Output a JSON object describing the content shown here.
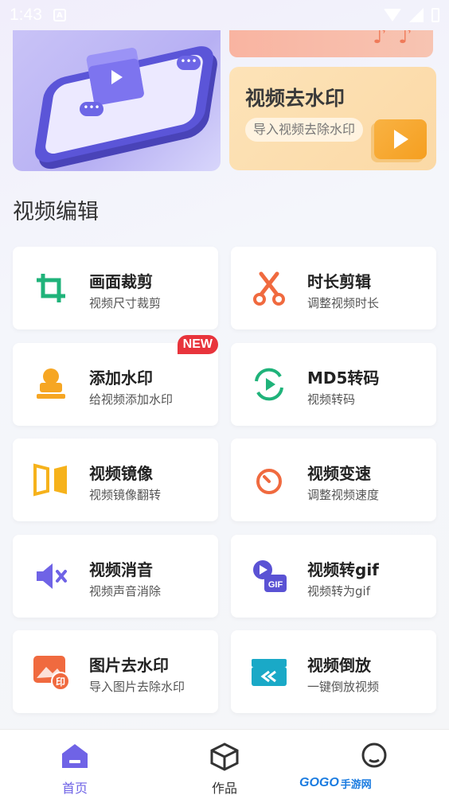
{
  "status_bar": {
    "time": "1:43",
    "indicator": "A"
  },
  "banner": {
    "watermark_title": "视频去水印",
    "watermark_subtitle": "导入视频去除水印"
  },
  "section": {
    "title": "视频编辑"
  },
  "tools": [
    {
      "title": "画面裁剪",
      "subtitle": "视频尺寸裁剪",
      "icon": "crop-icon",
      "color": "#1fb37a"
    },
    {
      "title": "时长剪辑",
      "subtitle": "调整视频时长",
      "icon": "scissors-icon",
      "color": "#f06a3f"
    },
    {
      "title": "添加水印",
      "subtitle": "给视频添加水印",
      "icon": "stamp-icon",
      "color": "#f6a623",
      "badge": "NEW"
    },
    {
      "title": "MD5转码",
      "subtitle": "视频转码",
      "icon": "transcode-icon",
      "color": "#1fb37a"
    },
    {
      "title": "视频镜像",
      "subtitle": "视频镜像翻转",
      "icon": "mirror-icon",
      "color": "#f6b21b"
    },
    {
      "title": "视频变速",
      "subtitle": "调整视频速度",
      "icon": "speed-icon",
      "color": "#f06a3f"
    },
    {
      "title": "视频消音",
      "subtitle": "视频声音消除",
      "icon": "mute-icon",
      "color": "#6f63e6"
    },
    {
      "title": "视频转gif",
      "subtitle": "视频转为gif",
      "icon": "gif-icon",
      "color": "#5a52d4"
    },
    {
      "title": "图片去水印",
      "subtitle": "导入图片去除水印",
      "icon": "image-watermark-icon",
      "color": "#f06a3f"
    },
    {
      "title": "视频倒放",
      "subtitle": "一键倒放视频",
      "icon": "rewind-icon",
      "color": "#1aa9c7"
    }
  ],
  "tabbar": {
    "home_label": "首页",
    "works_label": "作品",
    "active_color": "#6f63e6"
  },
  "watermark_logo": {
    "brand": "GOGO",
    "suffix": "手游网"
  }
}
